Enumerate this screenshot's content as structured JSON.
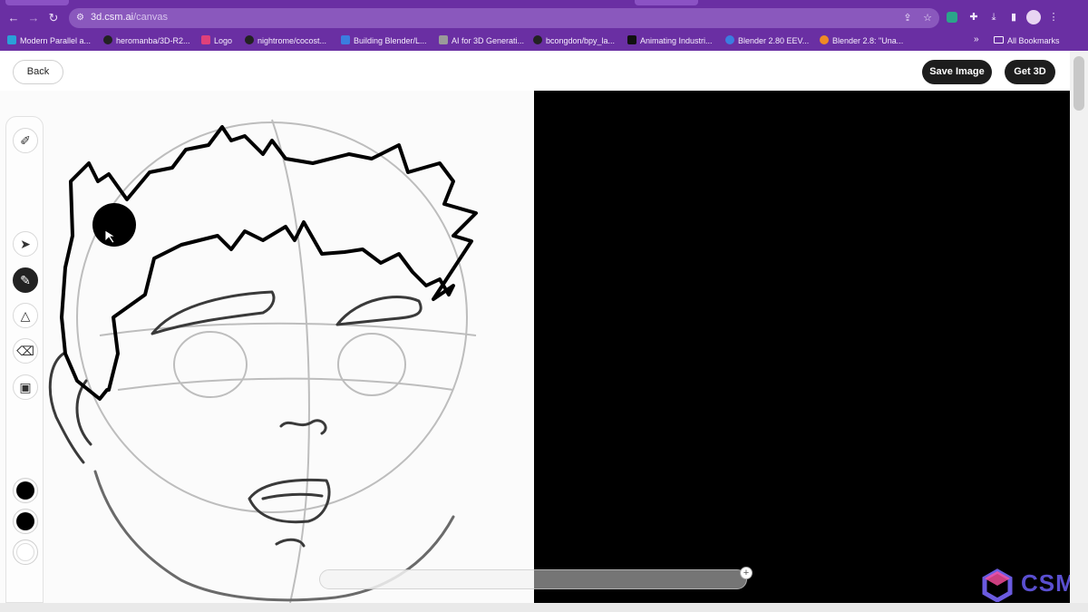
{
  "browser": {
    "url_host": "3d.csm.ai",
    "url_path": "/canvas",
    "bookmarks": [
      {
        "label": "Modern Parallel a...",
        "color": "#2aa0d8"
      },
      {
        "label": "heromanba/3D-R2...",
        "color": "#222222"
      },
      {
        "label": "Logo",
        "color": "#e0407a"
      },
      {
        "label": "nightrome/cocost...",
        "color": "#222222"
      },
      {
        "label": "Building Blender/L...",
        "color": "#3b7de0"
      },
      {
        "label": "AI for 3D Generati...",
        "color": "#9a9a9a"
      },
      {
        "label": "bcongdon/bpy_la...",
        "color": "#222222"
      },
      {
        "label": "Animating Industri...",
        "color": "#111111"
      },
      {
        "label": "Blender 2.80 EEV...",
        "color": "#3b7de0"
      },
      {
        "label": "Blender 2.8: \"Una...",
        "color": "#f08a24"
      }
    ],
    "overflow": "»",
    "all_bookmarks": "All Bookmarks"
  },
  "app": {
    "back_label": "Back",
    "save_label": "Save Image",
    "get3d_label": "Get 3D",
    "brand": "CSM"
  },
  "tools": [
    {
      "name": "brush-settings-icon",
      "glyph": "✐",
      "active": false
    },
    {
      "name": "select-arrow-icon",
      "glyph": "➤",
      "active": false
    },
    {
      "name": "pen-icon",
      "glyph": "✎",
      "active": true
    },
    {
      "name": "shapes-icon",
      "glyph": "△",
      "active": false
    },
    {
      "name": "eraser-icon",
      "glyph": "⌫",
      "active": false
    },
    {
      "name": "image-icon",
      "glyph": "▣",
      "active": false
    }
  ],
  "swatches": [
    {
      "name": "stroke-color-swatch",
      "color": "#000000"
    },
    {
      "name": "fill-color-swatch",
      "color": "#000000"
    },
    {
      "name": "background-color-swatch",
      "color": "#ffffff"
    }
  ],
  "colors": {
    "browser_accent": "#6a2fa3",
    "button_dark": "#1d1d1d",
    "brand": "#5a4fd0"
  }
}
